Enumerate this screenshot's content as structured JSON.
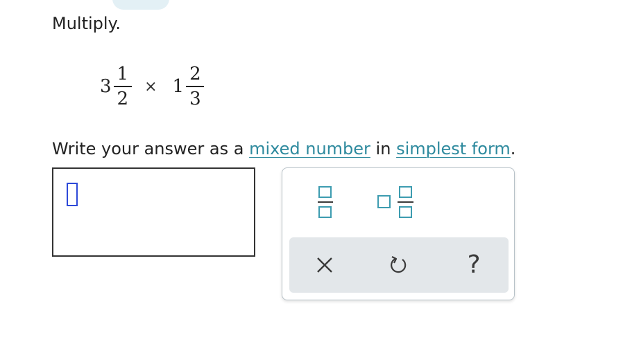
{
  "question": {
    "prompt": "Multiply.",
    "expression": {
      "first": {
        "whole": "3",
        "numerator": "1",
        "denominator": "2"
      },
      "operator": "×",
      "second": {
        "whole": "1",
        "numerator": "2",
        "denominator": "3"
      }
    },
    "instruction": {
      "prefix": "Write your answer as a",
      "link1": "mixed number",
      "middle": "in",
      "link2": "simplest form",
      "suffix": "."
    }
  },
  "answer": {
    "value": ""
  },
  "keypad": {
    "buttons": [
      "fraction-icon",
      "mixed-number-icon"
    ],
    "actions": [
      "clear-icon",
      "undo-icon",
      "help-icon"
    ],
    "help_label": "?"
  },
  "colors": {
    "link": "#2e8a9e",
    "icon_teal": "#3d9cb0",
    "caret": "#2d49d8",
    "action_bar_bg": "#e3e7ea"
  }
}
